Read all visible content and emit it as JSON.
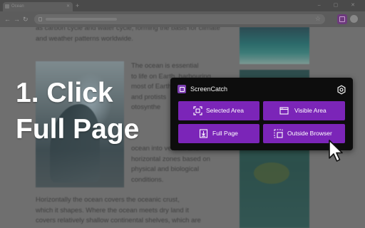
{
  "browser": {
    "tab_title": "Ocean",
    "tab_close": "✕",
    "new_tab": "+",
    "window_controls": "– ▢ ✕",
    "nav": {
      "back": "←",
      "forward": "→",
      "reload": "↻"
    },
    "bookmark_icon": "star-icon"
  },
  "article": {
    "intro": "as carbon cycle and water cycle, forming the basis for climate and weather patterns worldwide.",
    "side_text": "The ocean is essential to life on Earth, harbouring most of Earth's animals and protists ... photosynthesis ... ocean into vertical and horizontal zones based on physical and biological conditions.",
    "side_lines": [
      "The ocean is essential",
      "to life on Earth, harbouring",
      "most of Earth's animals",
      "and protists",
      "otosynthe",
      "",
      "",
      "",
      "ocean into vertical and",
      "horizontal zones based on",
      "physical and biological",
      "conditions."
    ],
    "bottom_lines": [
      "Horizontally the ocean covers the oceanic crust,",
      "which it shapes. Where the ocean meets dry land it",
      "covers relatively shallow continental shelves, which are"
    ]
  },
  "caption": {
    "line1": "1. Click",
    "line2": "Full Page"
  },
  "popup": {
    "title": "ScreenCatch",
    "buttons": {
      "selected_area": "Selected Area",
      "visible_area": "Visible Area",
      "full_page": "Full Page",
      "outside_browser": "Outside Browser"
    }
  },
  "colors": {
    "popup_bg": "#0d0d0d",
    "button_purple": "#7b25b8",
    "accent": "#7c3fb0",
    "caption_text": "#ffffff"
  }
}
